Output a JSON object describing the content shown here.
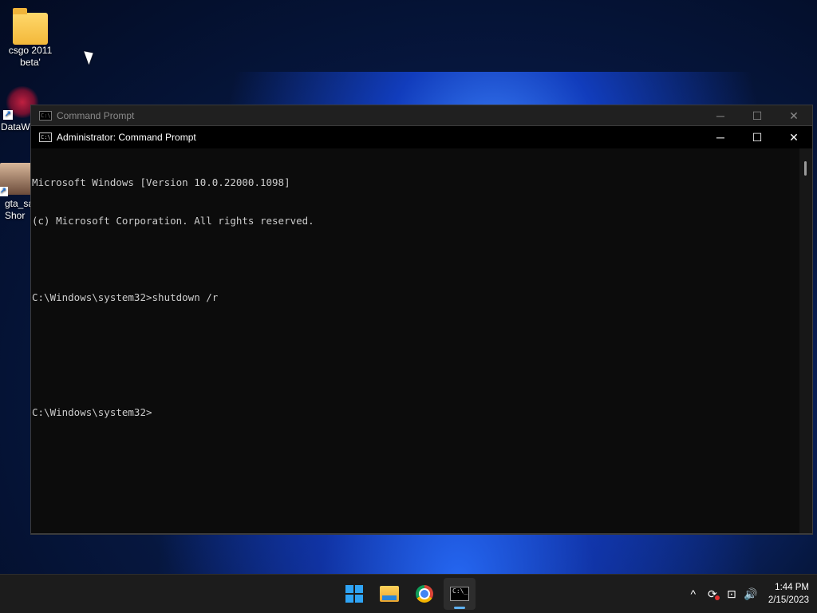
{
  "desktop": {
    "icons": [
      {
        "label": "csgo 2011 beta'",
        "icon": "folder-icon"
      },
      {
        "label": "DataW",
        "icon": "app-shortcut-icon"
      },
      {
        "label": "gta_sa\nShor",
        "icon": "image-shortcut-icon"
      }
    ]
  },
  "background_window": {
    "title": "Command Prompt",
    "minimize": "─",
    "maximize": "☐",
    "close": "✕"
  },
  "window": {
    "title": "Administrator: Command Prompt",
    "minimize": "─",
    "maximize": "☐",
    "close": "✕",
    "icon_text": "C:\\",
    "console_lines": [
      "Microsoft Windows [Version 10.0.22000.1098]",
      "(c) Microsoft Corporation. All rights reserved.",
      "",
      "C:\\Windows\\system32>shutdown /r",
      "",
      "",
      "C:\\Windows\\system32>"
    ]
  },
  "taskbar": {
    "apps": [
      {
        "name": "Start",
        "icon": "windows-start-icon"
      },
      {
        "name": "File Explorer",
        "icon": "file-explorer-icon"
      },
      {
        "name": "Google Chrome",
        "icon": "chrome-icon"
      },
      {
        "name": "Command Prompt",
        "icon": "command-prompt-icon",
        "active": true
      }
    ],
    "cmd_icon_text": "C:\\_",
    "tray": {
      "chevron": "^",
      "update": "⟳",
      "network": "⊡",
      "volume": "🔊"
    },
    "time": "1:44 PM",
    "date": "2/15/2023"
  },
  "colors": {
    "console_bg": "#0c0c0c",
    "console_fg": "#cccccc",
    "taskbar_bg": "#1c1c1c",
    "accent": "#5fb2f2"
  }
}
